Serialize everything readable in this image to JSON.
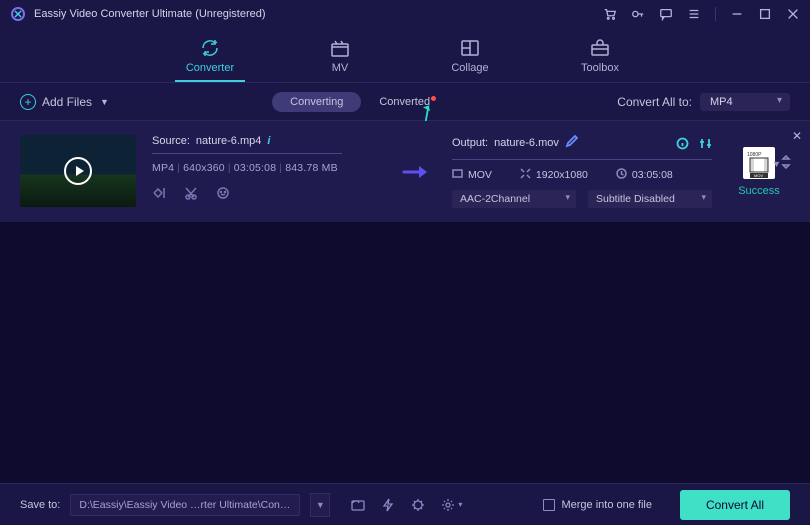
{
  "titlebar": {
    "title": "Eassiy Video Converter Ultimate (Unregistered)"
  },
  "nav": {
    "items": [
      {
        "label": "Converter",
        "icon": "refresh-icon"
      },
      {
        "label": "MV",
        "icon": "media-icon"
      },
      {
        "label": "Collage",
        "icon": "collage-icon"
      },
      {
        "label": "Toolbox",
        "icon": "toolbox-icon"
      }
    ]
  },
  "toolbar": {
    "add_files_label": "Add Files",
    "tab_converting": "Converting",
    "tab_converted": "Converted",
    "convert_all_label": "Convert All to:",
    "convert_all_value": "MP4"
  },
  "file": {
    "source_label": "Source:",
    "source_name": "nature-6.mp4",
    "format": "MP4",
    "resolution": "640x360",
    "duration": "03:05:08",
    "size": "843.78 MB",
    "output_label": "Output:",
    "output_name": "nature-6.mov",
    "out_format": "MOV",
    "out_resolution": "1920x1080",
    "out_duration": "03:05:08",
    "audio_channel": "AAC-2Channel",
    "subtitle": "Subtitle Disabled",
    "badge_top": "1080P",
    "output_status": "Success"
  },
  "footer": {
    "save_label": "Save to:",
    "save_path": "D:\\Eassiy\\Eassiy Video …rter Ultimate\\Converted",
    "merge_label": "Merge into one file",
    "convert_all_btn": "Convert All"
  }
}
